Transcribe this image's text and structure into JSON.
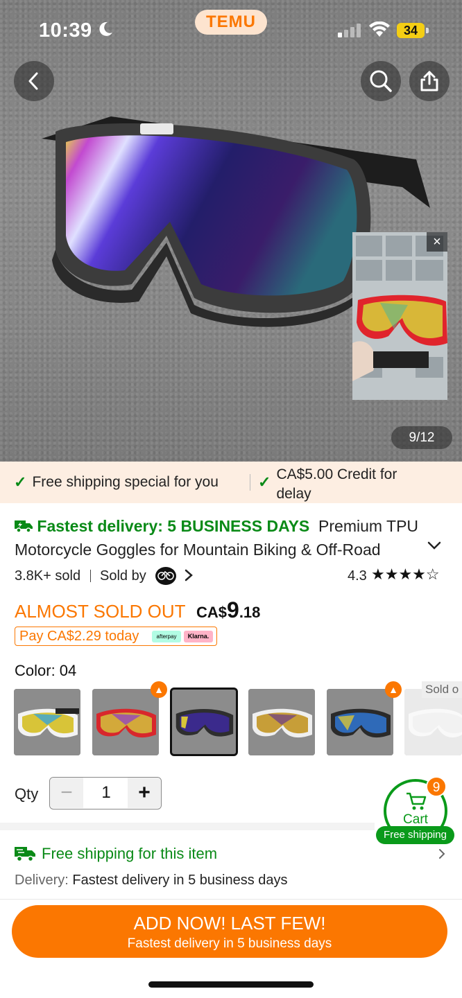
{
  "status": {
    "time": "10:39",
    "app_pill": "TEMU",
    "battery": "34"
  },
  "gallery": {
    "pager": "9/12",
    "video_close": "×"
  },
  "promo": {
    "free_shipping": "Free shipping special for you",
    "credit_line1": "CA$5.00 Credit for",
    "credit_line2": "delay"
  },
  "product": {
    "fastest": "Fastest delivery: 5 BUSINESS DAYS",
    "title": "Premium TPU Motorcycle Goggles for Mountain Biking & Off-Road",
    "sold": "3.8K+ sold",
    "sold_by": "Sold by",
    "rating": "4.3",
    "stars": "★★★★☆"
  },
  "price": {
    "almost": "ALMOST SOLD OUT",
    "currency": "CA$",
    "main": "9",
    "cents": ".18",
    "pay_today": "Pay CA$2.29 today",
    "afterpay": "afterpay",
    "klarna": "Klarna."
  },
  "color": {
    "label": "Color: 04",
    "sold_out": "Sold o",
    "swatches": [
      "white",
      "red",
      "black",
      "white-gold",
      "black-blue",
      "clear"
    ]
  },
  "qty": {
    "label": "Qty",
    "value": "1",
    "minus": "−",
    "plus": "+"
  },
  "cart": {
    "label": "Cart",
    "count": "9",
    "free_shipping": "Free shipping"
  },
  "shipping": {
    "title": "Free shipping for this item",
    "delivery_key": "Delivery:",
    "delivery_val": "Fastest delivery in 5 business days"
  },
  "cta": {
    "line1": "ADD NOW! LAST FEW!",
    "line2": "Fastest delivery in 5 business days"
  },
  "colors": {
    "accent": "#fb7701",
    "green": "#0a8a17",
    "promo_bg": "#fdeee2"
  }
}
